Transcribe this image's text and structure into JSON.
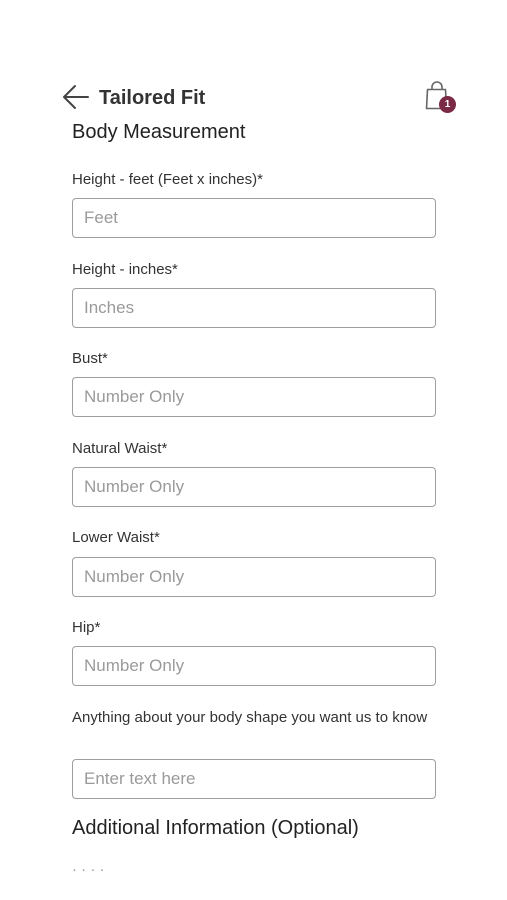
{
  "header": {
    "title": "Tailored Fit",
    "cart_count": "1"
  },
  "section": {
    "title": "Body Measurement"
  },
  "fields": [
    {
      "label": "Height - feet (Feet x inches)*",
      "placeholder": "Feet",
      "value": ""
    },
    {
      "label": "Height - inches*",
      "placeholder": "Inches",
      "value": ""
    },
    {
      "label": "Bust*",
      "placeholder": "Number Only",
      "value": ""
    },
    {
      "label": "Natural Waist*",
      "placeholder": "Number Only",
      "value": ""
    },
    {
      "label": "Lower Waist*",
      "placeholder": "Number Only",
      "value": ""
    },
    {
      "label": "Hip*",
      "placeholder": "Number Only",
      "value": ""
    },
    {
      "label": "Anything about your body shape you want us to know",
      "placeholder": "Enter text here",
      "value": ""
    }
  ],
  "additional": {
    "title": "Additional Information (Optional)"
  },
  "icons": {
    "back": "arrow-left-icon",
    "cart": "shopping-bag-icon"
  },
  "colors": {
    "badge": "#7a2a45",
    "border": "#9e9e9e",
    "placeholder": "#9a9a9a"
  }
}
